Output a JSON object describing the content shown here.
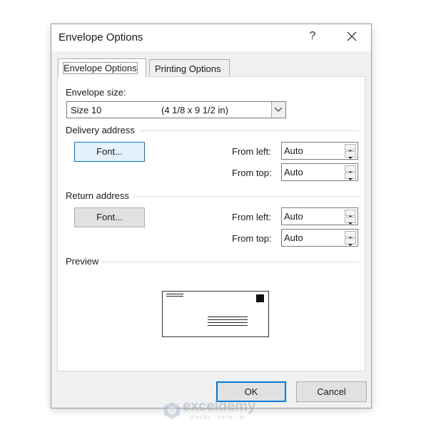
{
  "window": {
    "title": "Envelope Options",
    "help_icon": "?",
    "close_icon": "close-icon"
  },
  "tabs": [
    {
      "label": "Envelope Options",
      "mnemonic": "E",
      "active": true
    },
    {
      "label": "Printing Options",
      "mnemonic": "P",
      "active": false
    }
  ],
  "envelope_size": {
    "label": "Envelope size:",
    "selected_name": "Size 10",
    "selected_dimensions": "(4 1/8 x 9 1/2 in)"
  },
  "delivery_address": {
    "heading": "Delivery address",
    "font_button": "Font...",
    "from_left_label": "From left:",
    "from_left_value": "Auto",
    "from_top_label": "From top:",
    "from_top_value": "Auto"
  },
  "return_address": {
    "heading": "Return address",
    "font_button": "Font...",
    "from_left_label": "From left:",
    "from_left_value": "Auto",
    "from_top_label": "From top:",
    "from_top_value": "Auto"
  },
  "preview": {
    "heading": "Preview"
  },
  "buttons": {
    "ok": "OK",
    "cancel": "Cancel"
  },
  "watermark": {
    "name": "exceldemy",
    "tagline": "EXCEL · DATA · BI"
  },
  "colors": {
    "accent": "#0078d7",
    "dialog_bg": "#f0f0f0",
    "button_bg": "#e1e1e1"
  }
}
